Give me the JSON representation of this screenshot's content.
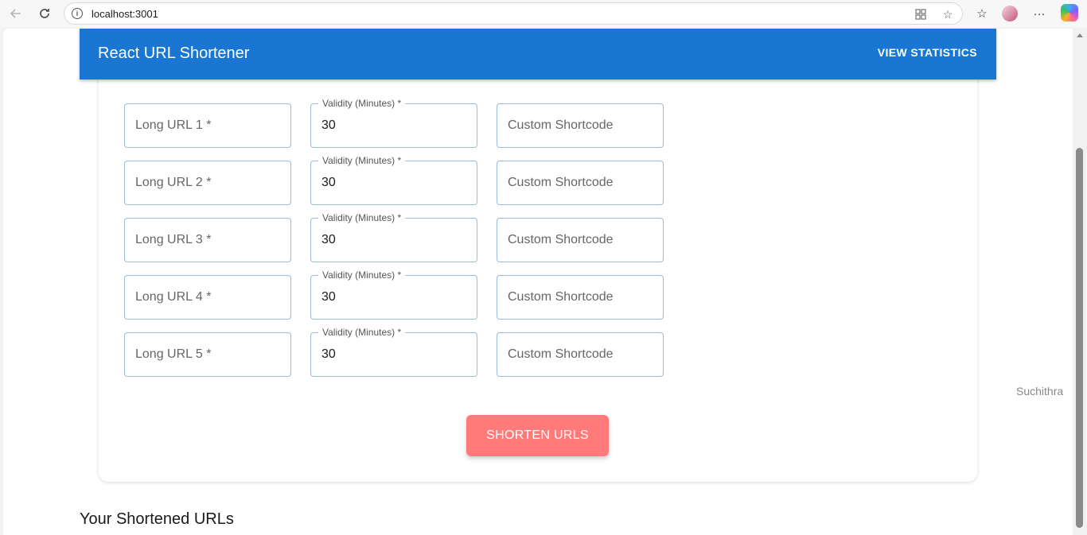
{
  "browser": {
    "url": "localhost:3001",
    "info_icon": "info-icon",
    "back_icon": "arrow-left-icon",
    "reload_icon": "reload-icon"
  },
  "app": {
    "title": "React URL Shortener",
    "nav_button": "VIEW STATISTICS"
  },
  "form": {
    "rows": [
      {
        "long_url_placeholder": "Long URL 1 *",
        "validity_label": "Validity (Minutes) *",
        "validity_value": "30",
        "shortcode_placeholder": "Custom Shortcode"
      },
      {
        "long_url_placeholder": "Long URL 2 *",
        "validity_label": "Validity (Minutes) *",
        "validity_value": "30",
        "shortcode_placeholder": "Custom Shortcode"
      },
      {
        "long_url_placeholder": "Long URL 3 *",
        "validity_label": "Validity (Minutes) *",
        "validity_value": "30",
        "shortcode_placeholder": "Custom Shortcode"
      },
      {
        "long_url_placeholder": "Long URL 4 *",
        "validity_label": "Validity (Minutes) *",
        "validity_value": "30",
        "shortcode_placeholder": "Custom Shortcode"
      },
      {
        "long_url_placeholder": "Long URL 5 *",
        "validity_label": "Validity (Minutes) *",
        "validity_value": "30",
        "shortcode_placeholder": "Custom Shortcode"
      }
    ],
    "submit_label": "SHORTEN URLS"
  },
  "side_label": "Suchithra",
  "results_title": "Your Shortened URLs",
  "colors": {
    "appbar": "#1976d2",
    "submit_button": "#ff7a7a",
    "field_border": "#9bbbe0"
  }
}
